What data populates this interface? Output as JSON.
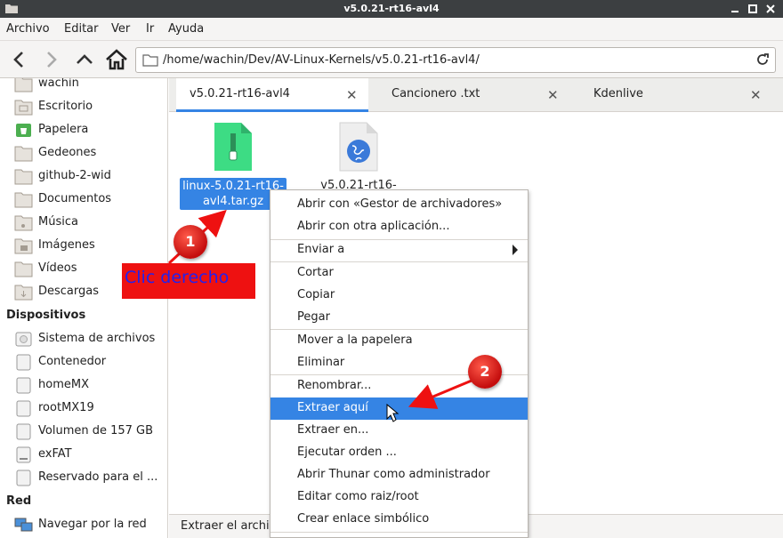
{
  "window": {
    "title": "v5.0.21-rt16-avl4",
    "controls": [
      "minimize-icon",
      "maximize-icon",
      "close-icon"
    ]
  },
  "menubar": {
    "items": [
      "Archivo",
      "Editar",
      "Ver",
      "Ir",
      "Ayuda"
    ]
  },
  "toolbar": {
    "address": "/home/wachin/Dev/AV-Linux-Kernels/v5.0.21-rt16-avl4/",
    "icons": [
      "back-icon",
      "forward-icon",
      "up-icon",
      "home-icon",
      "folder-icon",
      "reload-icon"
    ]
  },
  "sidebar": {
    "places": [
      {
        "label": "wachin",
        "icon": "home-folder-icon"
      },
      {
        "label": "Escritorio",
        "icon": "desktop-folder-icon"
      },
      {
        "label": "Papelera",
        "icon": "trash-icon"
      },
      {
        "label": "Gedeones",
        "icon": "folder-icon"
      },
      {
        "label": "github-2-wid",
        "icon": "folder-icon"
      },
      {
        "label": "Documentos",
        "icon": "folder-icon"
      },
      {
        "label": "Música",
        "icon": "music-folder-icon"
      },
      {
        "label": "Imágenes",
        "icon": "pictures-folder-icon"
      },
      {
        "label": "Vídeos",
        "icon": "videos-folder-icon"
      },
      {
        "label": "Descargas",
        "icon": "downloads-folder-icon"
      }
    ],
    "devices_heading": "Dispositivos",
    "devices": [
      {
        "label": "Sistema de archivos",
        "icon": "drive-icon"
      },
      {
        "label": "Contenedor",
        "icon": "drive-icon"
      },
      {
        "label": "homeMX",
        "icon": "drive-icon"
      },
      {
        "label": "rootMX19",
        "icon": "drive-icon"
      },
      {
        "label": "Volumen de 157 GB",
        "icon": "drive-icon"
      },
      {
        "label": "exFAT",
        "icon": "drive-icon"
      },
      {
        "label": "Reservado para el ...",
        "icon": "drive-icon"
      }
    ],
    "network_heading": "Red",
    "network": [
      {
        "label": "Navegar por la red",
        "icon": "network-icon"
      }
    ]
  },
  "tabs": [
    {
      "label": "v5.0.21-rt16-avl4",
      "active": true
    },
    {
      "label": "Cancionero .txt",
      "active": false
    },
    {
      "label": "Kdenlive",
      "active": false
    }
  ],
  "files": [
    {
      "label": "linux-5.0.21-rt16-avl4.tar.gz",
      "icon": "archive-icon",
      "selected": true
    },
    {
      "label": "v5.0.21-rt16-",
      "icon": "html-file-icon",
      "selected": false
    }
  ],
  "context_menu": {
    "items": [
      {
        "label": "Abrir con «Gestor de archivadores»"
      },
      {
        "label": "Abrir con otra aplicación..."
      },
      {
        "label": "Enviar a",
        "submenu": true
      },
      {
        "label": "Cortar"
      },
      {
        "label": "Copiar"
      },
      {
        "label": "Pegar"
      },
      {
        "label": "Mover a la papelera"
      },
      {
        "label": "Eliminar"
      },
      {
        "label": "Renombrar..."
      },
      {
        "label": "Extraer aquí",
        "highlighted": true
      },
      {
        "label": "Extraer en..."
      },
      {
        "label": "Ejecutar orden ..."
      },
      {
        "label": "Abrir Thunar como administrador"
      },
      {
        "label": "Editar como raiz/root"
      },
      {
        "label": "Crear enlace simbólico"
      }
    ]
  },
  "statusbar": {
    "text": "Extraer el archi"
  },
  "annotations": {
    "callout_text": "Clic derecho",
    "badge_1": "1",
    "badge_2": "2",
    "color": "#ee1111"
  },
  "colors": {
    "accent": "#3584e4",
    "titlebar": "#3c3f41",
    "archive": "#3ddc84"
  }
}
